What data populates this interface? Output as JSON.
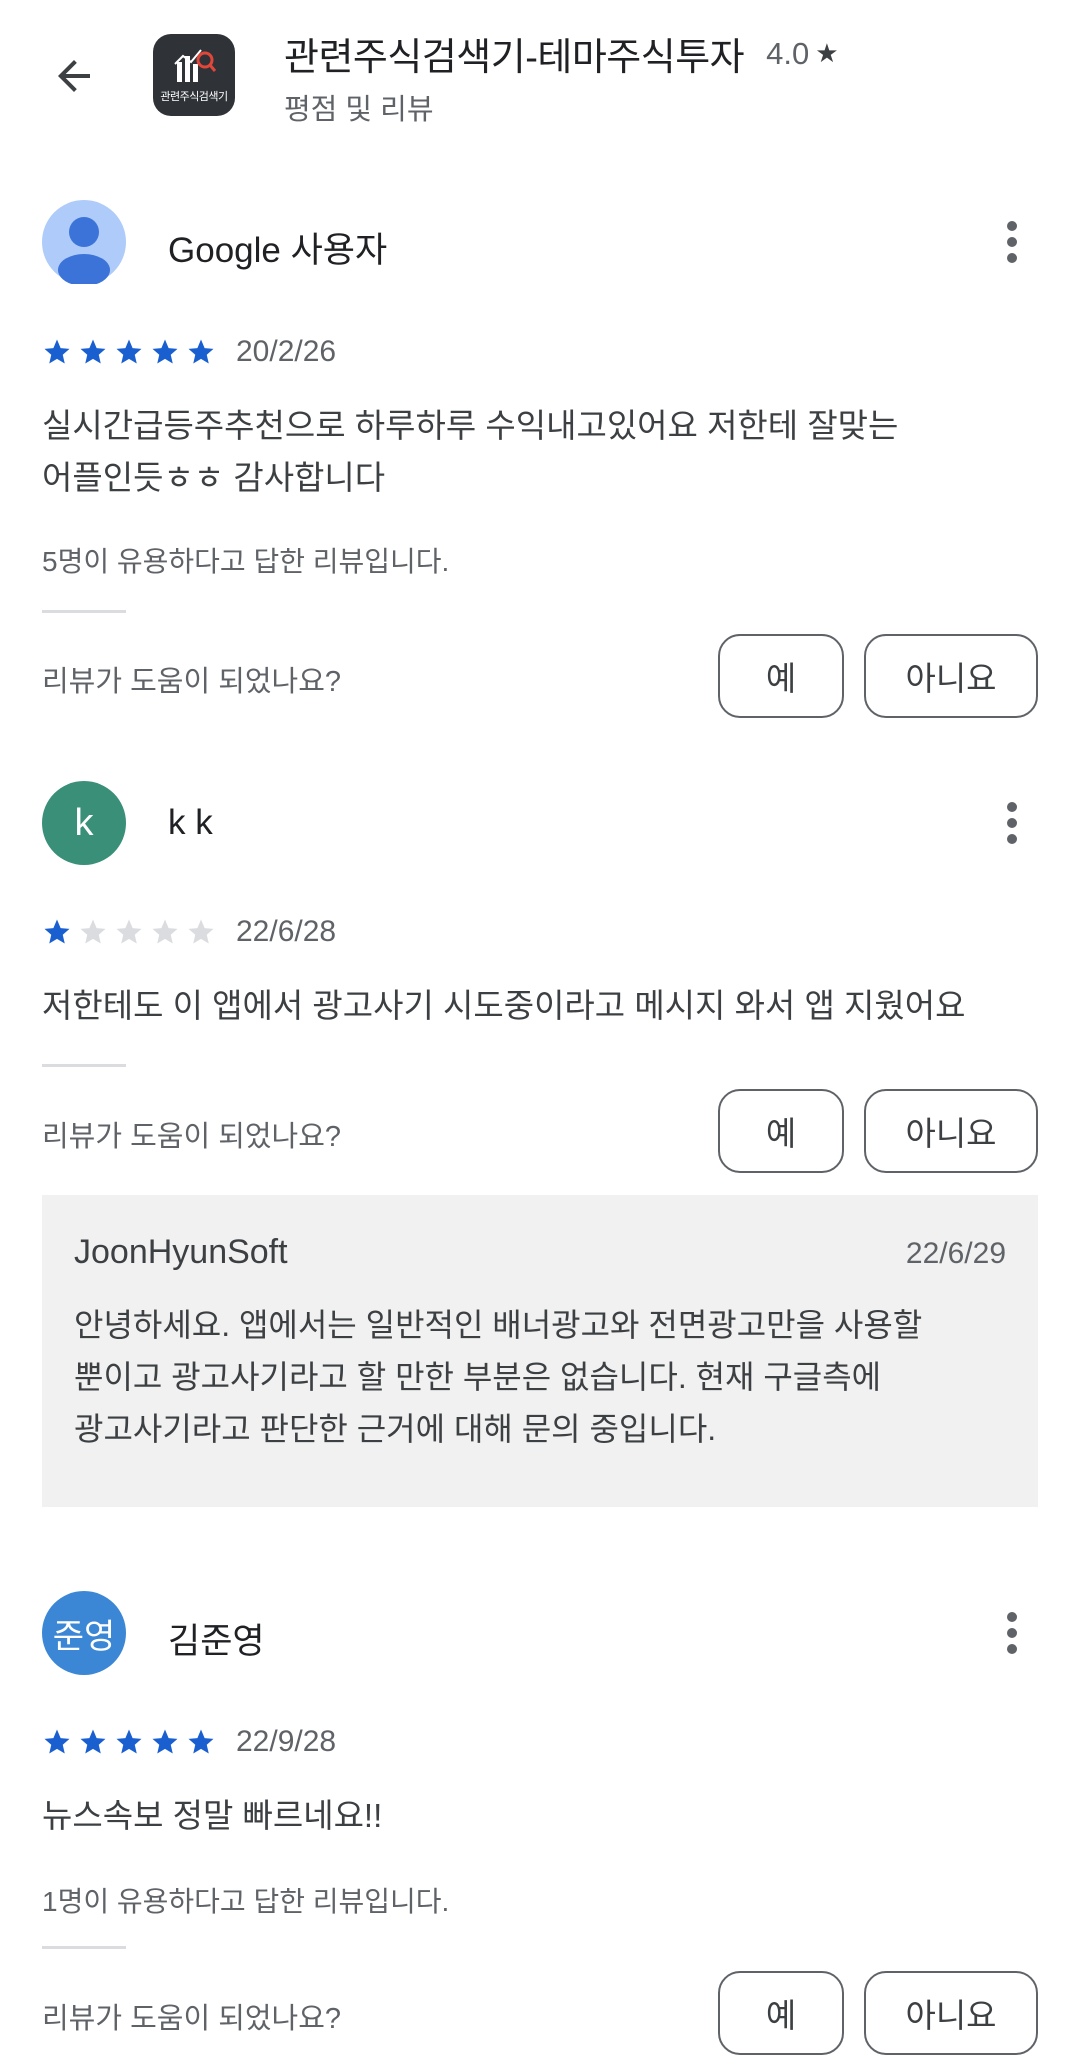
{
  "app": {
    "title": "관련주식검색기-테마주식투자",
    "rating": "4.0",
    "rating_star": "★",
    "subtitle": "평점 및 리뷰",
    "icon_label": "관련주식검색기"
  },
  "helpful_question": "리뷰가 도움이 되었나요?",
  "yes_label": "예",
  "no_label": "아니요",
  "reviews": [
    {
      "author": "Google 사용자",
      "avatar_color": "#aecbfa",
      "rating": 5,
      "date": "20/2/26",
      "text_line1": "실시간급등주추천으로 하루하루 수익내고있어요 저한테 잘맞는",
      "text_line2": "어플인듯ㅎㅎ 감사합니다",
      "helpful_count": "5명이 유용하다고 답한 리뷰입니다."
    },
    {
      "author": "k k",
      "avatar_letter": "k",
      "avatar_color": "#3a8f78",
      "rating": 1,
      "date": "22/6/28",
      "text_line1": "저한테도 이 앱에서 광고사기 시도중이라고 메시지 와서 앱 지웠어요",
      "reply": {
        "author": "JoonHyunSoft",
        "date": "22/6/29",
        "line1": "안녕하세요. 앱에서는 일반적인 배너광고와 전면광고만을 사용할",
        "line2": "뿐이고 광고사기라고 할 만한 부분은 없습니다. 현재 구글측에",
        "line3": "광고사기라고 판단한 근거에 대해 문의 중입니다."
      }
    },
    {
      "author": "김준영",
      "avatar_letter": "준영",
      "avatar_color": "#3b87d6",
      "rating": 5,
      "date": "22/9/28",
      "text_line1": "뉴스속보 정말 빠르네요!!",
      "helpful_count": "1명이 유용하다고 답한 리뷰입니다."
    }
  ],
  "colors": {
    "star_filled": "#1a5fd0",
    "star_empty": "#dadce0"
  }
}
